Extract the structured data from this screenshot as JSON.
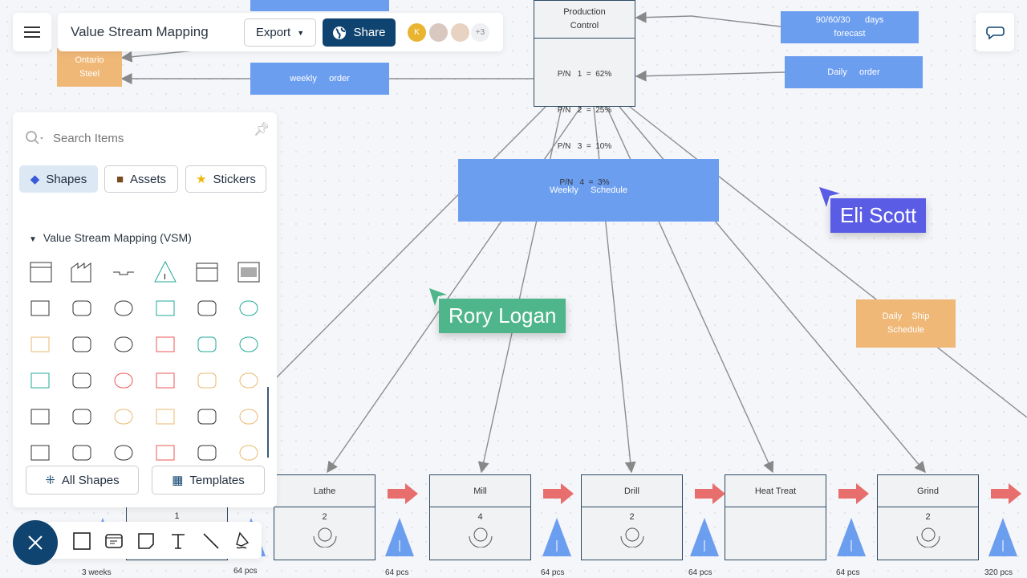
{
  "header": {
    "title": "Value Stream Mapping",
    "export_label": "Export",
    "share_label": "Share",
    "avatar_initial": "K",
    "more_count": "+3"
  },
  "canvas": {
    "production_control": {
      "title": "Production\nControl",
      "lines": [
        "P/N   1  =  62%",
        "P/N   2  =  25%",
        "P/N   3  =  10%",
        "P/N   4  =  3%"
      ]
    },
    "forecast": "90/60/30      days\nforecast",
    "daily_order": "Daily     order",
    "weekly_order": "weekly     order",
    "supplier": "Ontario\nSteel",
    "weekly_schedule": "Weekly     Schedule",
    "daily_ship": "Daily    Ship\nSchedule",
    "processes": [
      {
        "name": "Lathe",
        "count": "2"
      },
      {
        "name": "Mill",
        "count": "4"
      },
      {
        "name": "Drill",
        "count": "2"
      },
      {
        "name": "Heat   Treat",
        "count": ""
      },
      {
        "name": "Grind",
        "count": "2"
      }
    ],
    "partial_process_count": "1",
    "inventory_labels": [
      "3  weeks",
      "64  pcs",
      "64  pcs",
      "64  pcs",
      "64  pcs",
      "64  pcs",
      "320  pcs"
    ],
    "cursors": [
      {
        "name": "Rory Logan",
        "color": "#4fb58a"
      },
      {
        "name": "Eli Scott",
        "color": "#5b5ce6"
      }
    ]
  },
  "panel": {
    "search_placeholder": "Search Items",
    "tabs": [
      "Shapes",
      "Assets",
      "Stickers"
    ],
    "section": "Value Stream Mapping (VSM)",
    "all_shapes": "All Shapes",
    "templates": "Templates"
  },
  "colors": {
    "accent": "#0f4470",
    "blue_shape": "#6c9ef0",
    "orange_shape": "#f0b877",
    "push_arrow": "#e86d6d"
  }
}
